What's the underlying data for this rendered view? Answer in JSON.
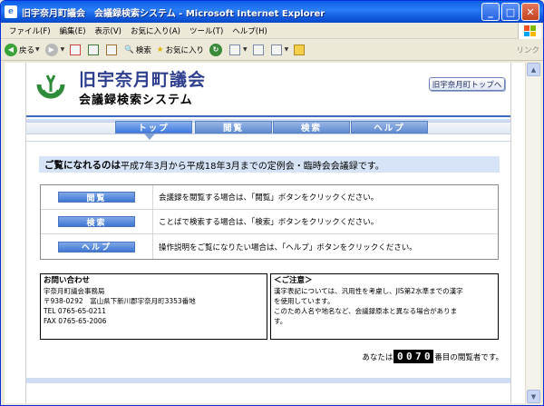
{
  "window": {
    "title": "旧宇奈月町議会　会議録検索システム - Microsoft Internet Explorer",
    "app_icon": "e",
    "min_glyph": "_",
    "max_glyph": "□",
    "close_glyph": "✕"
  },
  "menubar": {
    "items": [
      "ファイル(F)",
      "編集(E)",
      "表示(V)",
      "お気に入り(A)",
      "ツール(T)",
      "ヘルプ(H)"
    ]
  },
  "toolbar": {
    "back": "戻る",
    "search": "検索",
    "favorites": "お気に入り",
    "links": "リンク"
  },
  "site": {
    "title": "旧宇奈月町議会",
    "subtitle": "会議録検索システム",
    "home_button": "旧宇奈月町トップへ"
  },
  "nav": {
    "tabs": [
      "トップ",
      "閲覧",
      "検索",
      "ヘルプ"
    ],
    "active": 0
  },
  "notice": {
    "lead": "ご覧になれるのは",
    "text": "平成7年3月から平成18年3月までの定例会・臨時会会議録です。"
  },
  "actions": [
    {
      "button": "閲覧",
      "description": "会議録を閲覧する場合は、「閲覧」ボタンをクリックください。"
    },
    {
      "button": "検索",
      "description": "ことばで検索する場合は、「検索」ボタンをクリックください。"
    },
    {
      "button": "ヘルプ",
      "description": "操作説明をご覧になりたい場合は、「ヘルプ」ボタンをクリックください。"
    }
  ],
  "contact": {
    "title": "お問い合わせ",
    "lines": [
      "宇奈月町議会事務局",
      "〒938-0292　富山県下新川郡宇奈月町3353番地",
      "TEL 0765-65-0211",
      "FAX 0765-65-2006"
    ]
  },
  "caution": {
    "title": "＜ご注意＞",
    "lines": [
      "漢字表記については、汎用性を考慮し、JIS第2水準までの漢字",
      "を使用しています。",
      "このため人名や地名など、会議録原本と異なる場合がありま",
      "す。"
    ]
  },
  "counter": {
    "prefix": "あなたは",
    "digits": [
      "0",
      "0",
      "7",
      "0"
    ],
    "suffix": "番目の閲覧者です。"
  },
  "colors": {
    "accent_blue": "#3f77d4",
    "title_blue": "#2f3f8f",
    "notice_bg": "#d7e4f8",
    "logo_green": "#2e8b3a"
  }
}
